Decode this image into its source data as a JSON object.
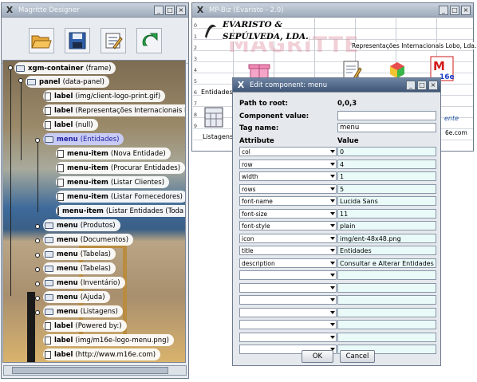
{
  "designer": {
    "title": "Magritte Designer",
    "tree": [
      {
        "type": "xgm-container",
        "detail": "(frame)"
      },
      {
        "type": "panel",
        "detail": "(data-panel)"
      },
      {
        "type": "label",
        "detail": "(img/client-logo-print.gif)"
      },
      {
        "type": "label",
        "detail": "(Representações Internacionais Lo"
      },
      {
        "type": "label",
        "detail": "(null)"
      },
      {
        "type": "menu",
        "detail": "(Entidades)"
      },
      {
        "type": "menu-item",
        "detail": "(Nova Entidade)"
      },
      {
        "type": "menu-item",
        "detail": "(Procurar Entidades)"
      },
      {
        "type": "menu-item",
        "detail": "(Listar Clientes)"
      },
      {
        "type": "menu-item",
        "detail": "(Listar Fornecedores)"
      },
      {
        "type": "menu-item",
        "detail": "(Listar Entidades (Toda"
      },
      {
        "type": "menu",
        "detail": "(Produtos)"
      },
      {
        "type": "menu",
        "detail": "(Documentos)"
      },
      {
        "type": "menu",
        "detail": "(Tabelas)"
      },
      {
        "type": "menu",
        "detail": "(Tabelas)"
      },
      {
        "type": "menu",
        "detail": "(Inventário)"
      },
      {
        "type": "menu",
        "detail": "(Ajuda)"
      },
      {
        "type": "menu",
        "detail": "(Listagens)"
      },
      {
        "type": "label",
        "detail": "(Powered by:)"
      },
      {
        "type": "label",
        "detail": "(img/m16e-logo-menu.png)"
      },
      {
        "type": "label",
        "detail": "(http://www.m16e.com)"
      }
    ]
  },
  "mpbiz": {
    "title": "MP-Biz (Evaristo - 2.0)",
    "company_line1": "EVARISTO &",
    "company_line2": "SEPÚLVEDA, LDA.",
    "company_sub": "Representações Internacionais Lobo, Lda.",
    "watermark": "MAGRITTE",
    "cells": {
      "entidades": "Entidades",
      "listagens": "Listagens",
      "site": "6e.com",
      "ente": "ente"
    }
  },
  "dialog": {
    "title": "Edit component: menu",
    "path_label": "Path to root:",
    "path_value": "0,0,3",
    "component_value_label": "Component value:",
    "component_value": "",
    "tag_name_label": "Tag name:",
    "tag_name": "menu",
    "col_attribute": "Attribute",
    "col_value": "Value",
    "rows": [
      {
        "attr": "col",
        "value": "0"
      },
      {
        "attr": "row",
        "value": "4"
      },
      {
        "attr": "width",
        "value": "1"
      },
      {
        "attr": "rows",
        "value": "5"
      },
      {
        "attr": "font-name",
        "value": "Lucida Sans"
      },
      {
        "attr": "font-size",
        "value": "11"
      },
      {
        "attr": "font-style",
        "value": "plain"
      },
      {
        "attr": "icon",
        "value": "img/ent-48x48.png"
      },
      {
        "attr": "title",
        "value": "Entidades"
      },
      {
        "attr": "description",
        "value": "Consultar e Alterar Entidades"
      },
      {
        "attr": "",
        "value": ""
      },
      {
        "attr": "",
        "value": ""
      },
      {
        "attr": "",
        "value": ""
      },
      {
        "attr": "",
        "value": ""
      },
      {
        "attr": "",
        "value": ""
      },
      {
        "attr": "",
        "value": ""
      },
      {
        "attr": "",
        "value": ""
      }
    ],
    "ok": "OK",
    "cancel": "Cancel"
  }
}
